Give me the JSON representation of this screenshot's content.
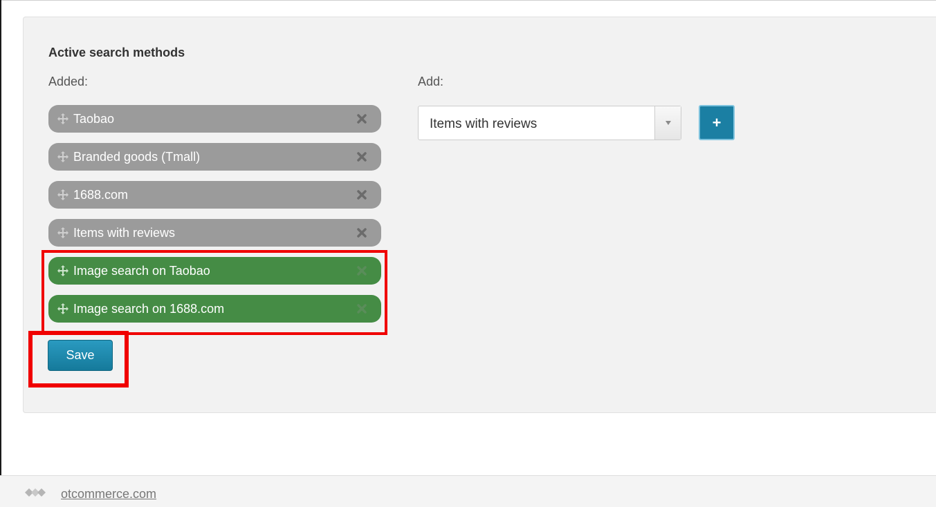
{
  "section": {
    "title": "Active search methods",
    "added_label": "Added:",
    "add_label": "Add:"
  },
  "added_methods": [
    {
      "label": "Taobao",
      "state": "inactive"
    },
    {
      "label": "Branded goods (Tmall)",
      "state": "inactive"
    },
    {
      "label": "1688.com",
      "state": "inactive"
    },
    {
      "label": "Items with reviews",
      "state": "inactive"
    },
    {
      "label": "Image search on Taobao",
      "state": "active"
    },
    {
      "label": "Image search on 1688.com",
      "state": "active"
    }
  ],
  "add_select": {
    "selected": "Items with reviews"
  },
  "buttons": {
    "add": "+",
    "save": "Save"
  },
  "footer": {
    "link": "otcommerce.com"
  },
  "colors": {
    "inactive_pill": "#9b9b9b",
    "active_pill": "#458c45",
    "primary_button": "#1b7fa3",
    "highlight": "#f00000"
  }
}
